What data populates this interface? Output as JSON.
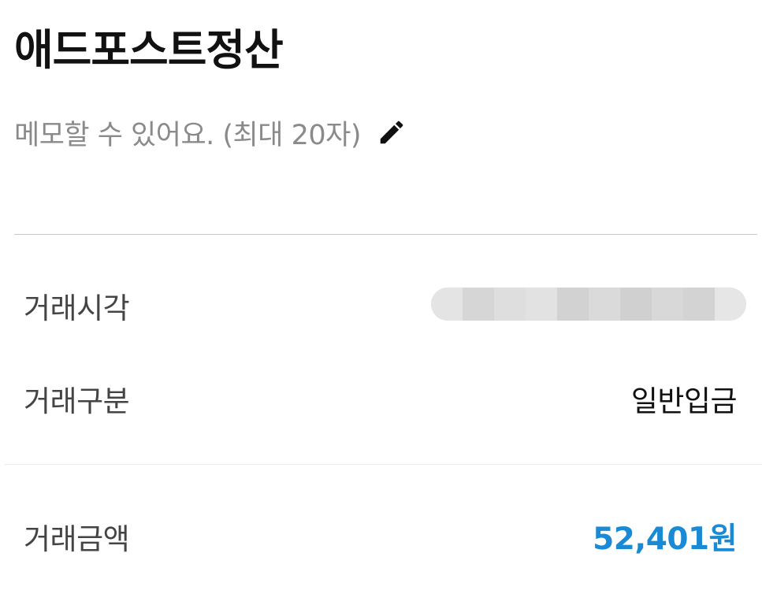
{
  "header": {
    "title": "애드포스트정산"
  },
  "memo": {
    "placeholder": "메모할 수 있어요. (최대 20자)",
    "edit_icon": "pencil-icon"
  },
  "details": {
    "time": {
      "label": "거래시각",
      "value": ""
    },
    "type": {
      "label": "거래구분",
      "value": "일반입금"
    },
    "amount": {
      "label": "거래금액",
      "value": "52,401원"
    }
  },
  "colors": {
    "amount": "#1a8ad4",
    "memo_text": "#8a8a8a",
    "divider": "#c8c8c8"
  }
}
